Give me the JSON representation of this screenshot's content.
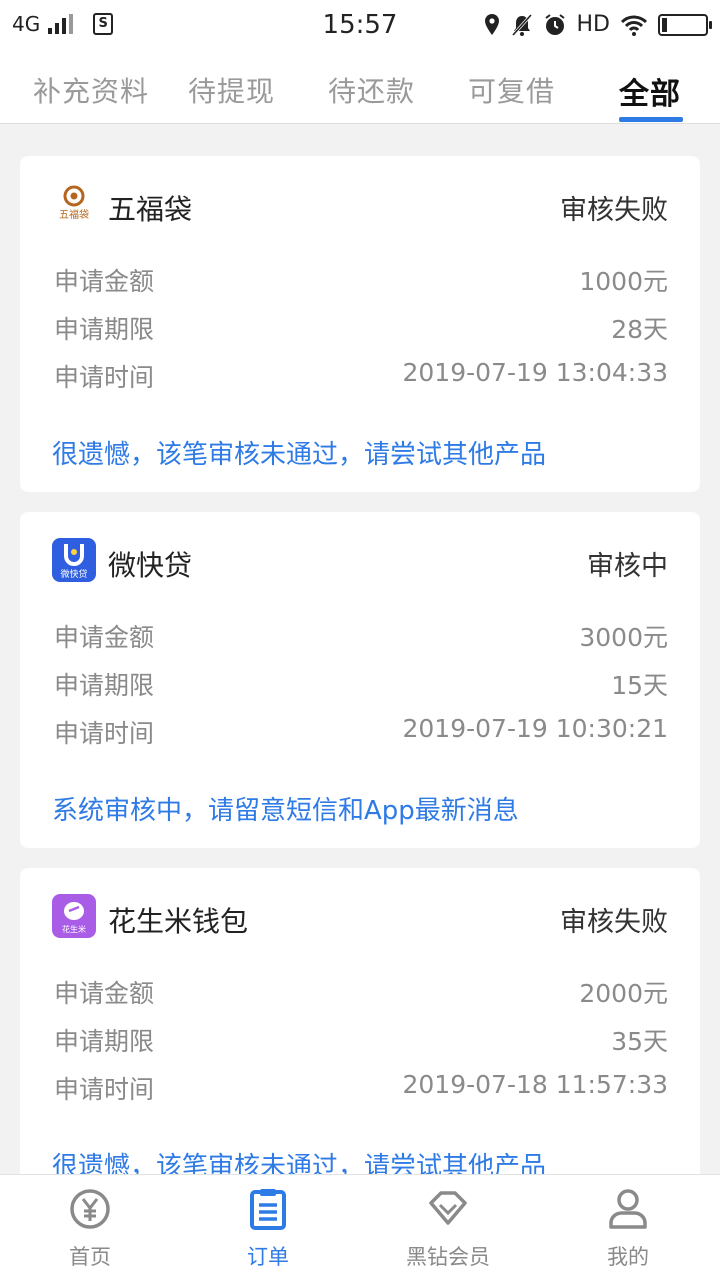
{
  "status_bar": {
    "network": "4G",
    "time": "15:57",
    "hd": "HD",
    "sim_icon": "sim-icon"
  },
  "tabs": [
    {
      "label": "补充资料"
    },
    {
      "label": "待提现"
    },
    {
      "label": "待还款"
    },
    {
      "label": "可复借"
    },
    {
      "label": "全部",
      "active": true
    }
  ],
  "labels": {
    "amount": "申请金额",
    "term": "申请期限",
    "time": "申请时间"
  },
  "cards": [
    {
      "name": "五福袋",
      "logo_text": "五福袋",
      "status": "审核失败",
      "amount": "1000元",
      "term": "28天",
      "time": "2019-07-19 13:04:33",
      "note": "很遗憾，该笔审核未通过，请尝试其他产品"
    },
    {
      "name": "微快贷",
      "logo_text": "微快贷",
      "status": "审核中",
      "amount": "3000元",
      "term": "15天",
      "time": "2019-07-19 10:30:21",
      "note": "系统审核中，请留意短信和App最新消息"
    },
    {
      "name": "花生米钱包",
      "logo_text": "花生米",
      "status": "审核失败",
      "amount": "2000元",
      "term": "35天",
      "time": "2019-07-18 11:57:33",
      "note": "很遗憾，该笔审核未通过，请尝试其他产品"
    }
  ],
  "bottom_nav": [
    {
      "label": "首页",
      "icon": "yen-icon"
    },
    {
      "label": "订单",
      "icon": "order-list-icon",
      "active": true
    },
    {
      "label": "黑钻会员",
      "icon": "diamond-icon"
    },
    {
      "label": "我的",
      "icon": "user-icon"
    }
  ],
  "colors": {
    "accent": "#2f7be6",
    "background": "#f2f2f2",
    "wufudai_brand": "#b5651d",
    "weikuaidai_brand": "#2f5fe0",
    "huashengmi_brand": "#a95de6"
  }
}
